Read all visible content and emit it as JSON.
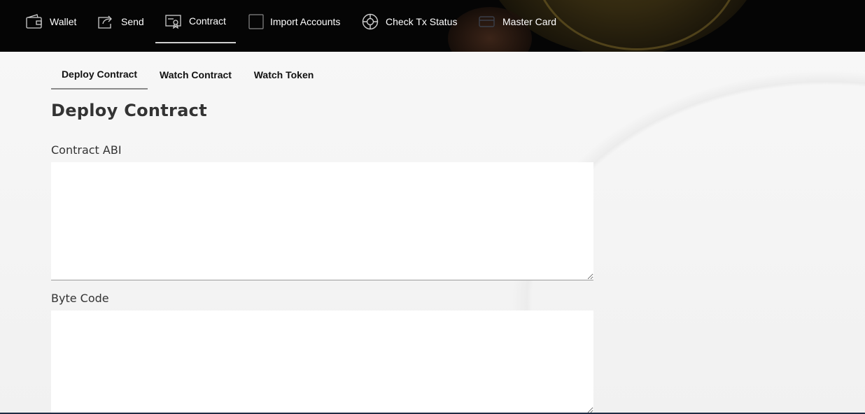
{
  "nav": {
    "items": [
      {
        "label": "Wallet",
        "icon": "wallet-icon"
      },
      {
        "label": "Send",
        "icon": "send-icon"
      },
      {
        "label": "Contract",
        "icon": "contract-icon",
        "active": true
      },
      {
        "label": "Import Accounts",
        "icon": "import-icon"
      },
      {
        "label": "Check Tx Status",
        "icon": "status-icon"
      },
      {
        "label": "Master Card",
        "icon": "card-icon"
      }
    ]
  },
  "tabs": [
    {
      "label": "Deploy Contract",
      "active": true
    },
    {
      "label": "Watch Contract"
    },
    {
      "label": "Watch Token"
    }
  ],
  "page": {
    "title": "Deploy Contract",
    "abi_label": "Contract ABI",
    "abi_value": "",
    "bytecode_label": "Byte Code",
    "bytecode_value": ""
  },
  "colors": {
    "nav_bg": "#050505",
    "page_bg": "#f3f3f3",
    "text": "#333333"
  }
}
